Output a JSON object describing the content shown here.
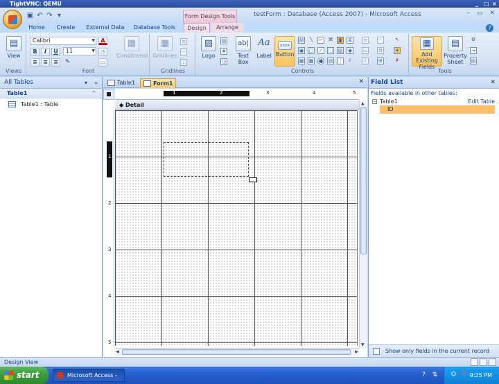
{
  "vnc": {
    "title": "TightVNC: QEMU",
    "controls": [
      "_",
      "□",
      "×"
    ]
  },
  "app": {
    "context_tab_title": "Form Design Tools",
    "window_title": "testForm : Database (Access 2007) - Microsoft Access",
    "win_controls": [
      "–",
      "▭",
      "✕"
    ]
  },
  "ribbon": {
    "tabs": [
      "Home",
      "Create",
      "External Data",
      "Database Tools",
      "Design",
      "Arrange"
    ],
    "active_tab": "Design",
    "groups": {
      "views": {
        "label": "Views",
        "view_button": "View"
      },
      "font": {
        "label": "Font",
        "font_name": "Calibri",
        "font_size": "11",
        "bold": "B",
        "italic": "I",
        "underline": "U",
        "font_color": "A",
        "conditional": "Conditional"
      },
      "gridlines": {
        "label": "Gridlines",
        "gridlines_button": "Gridlines"
      },
      "controls": {
        "label": "Controls",
        "logo": "Logo",
        "text_box_1": "Text",
        "text_box_2": "Box",
        "label_button": "Label",
        "button": "Button",
        "button_preview": "xxxx"
      },
      "tools": {
        "label": "Tools",
        "add_existing_1": "Add Existing",
        "add_existing_2": "Fields",
        "property_1": "Property",
        "property_2": "Sheet"
      }
    },
    "help": "?"
  },
  "nav": {
    "header": "All Tables",
    "group": "Table1",
    "item": "Table1 : Table"
  },
  "doc_tabs": [
    {
      "label": "Table1"
    },
    {
      "label": "Form1"
    }
  ],
  "design": {
    "section": "Detail",
    "h_ruler": [
      "1",
      "2",
      "3",
      "4",
      "5"
    ],
    "v_ruler": [
      "1",
      "2",
      "3",
      "4",
      "5"
    ]
  },
  "field_list": {
    "title": "Field List",
    "subtitle": "Fields available in other tables:",
    "table": "Table1",
    "edit_link": "Edit Table",
    "field": "ID",
    "footer": "Show only fields in the current record source"
  },
  "status": {
    "text": "Design View"
  },
  "taskbar": {
    "start": "start",
    "item": "Microsoft Access - te...",
    "clock": "9:25 PM"
  }
}
